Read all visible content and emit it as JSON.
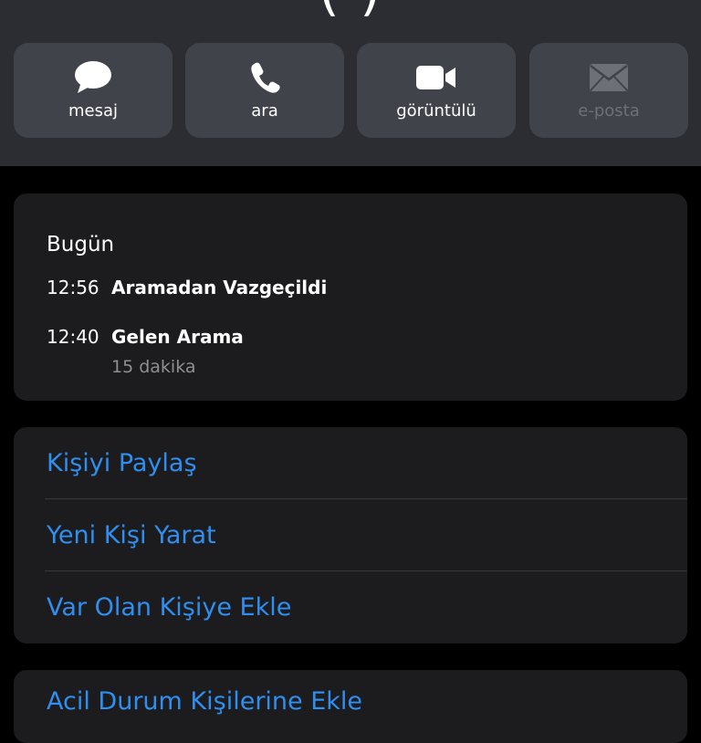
{
  "header": {
    "title_fragment": "(        )"
  },
  "actions": [
    {
      "label": "mesaj",
      "icon": "message-bubble-icon",
      "enabled": true
    },
    {
      "label": "ara",
      "icon": "phone-icon",
      "enabled": true
    },
    {
      "label": "görüntülü",
      "icon": "video-camera-icon",
      "enabled": true
    },
    {
      "label": "e-posta",
      "icon": "envelope-icon",
      "enabled": false
    }
  ],
  "recents": {
    "day": "Bugün",
    "calls": [
      {
        "time": "12:56",
        "type": "Aramadan Vazgeçildi",
        "duration": ""
      },
      {
        "time": "12:40",
        "type": "Gelen Arama",
        "duration": "15 dakika"
      }
    ]
  },
  "options": [
    {
      "label": "Kişiyi Paylaş"
    },
    {
      "label": "Yeni Kişi Yarat"
    },
    {
      "label": "Var Olan Kişiye Ekle"
    }
  ],
  "bottom_option": {
    "label": "Acil Durum Kişilerine Ekle"
  },
  "colors": {
    "accent": "#2f8ff0",
    "background": "#000000",
    "card": "#1c1c1e",
    "header": "#2b2d33",
    "action_button": "#41434b"
  }
}
